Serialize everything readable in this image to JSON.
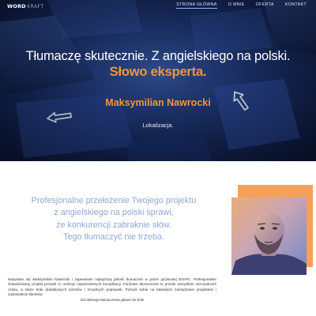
{
  "brand": {
    "word": "WORD",
    "kraft": "KRAFT"
  },
  "nav": {
    "items": [
      {
        "label": "STRONA GŁÓWNA"
      },
      {
        "label": "O MNIE"
      },
      {
        "label": "OFERTA"
      },
      {
        "label": "KONTAKT"
      }
    ]
  },
  "hero": {
    "headline": "Tłumaczę skutecznie. Z angielskiego na polski.",
    "tagline": "Słowo eksperta.",
    "name": "Maksymilian Nawrocki",
    "subtitle": "Lokalizacja."
  },
  "intro": {
    "lines": [
      "Profesjonalne przełożenie Twojego projektu",
      "z angielskiego na polski sprawi,",
      "że konkurencji zabraknie słów.",
      "Tego tłumaczyć nie trzeba."
    ]
  },
  "about": {
    "paragraph": "Nazywam się Maksymilian Nawrocki i zapewniam najwyższą jakość tłumaczeń w parze językowej EN>PL. Profesjonalnie zlokalizowany projekt pozwoli Ci uniknąć niepotrzebnych komplikacji. Fachowe tłumaczenie to przede wszystkim oszczędność czasu, a także brak dodatkowych kosztów i żmudnych poprawek. Pozwól sobie na łatwiejsze zarządzanie projektami i zadowolenie klientów.",
    "closing": "Od dobrego tłumaczenia głowa nie boli!"
  },
  "colors": {
    "accent": "#f39539",
    "hero_bg": "#1d3470",
    "lead_text": "#8ea7d8"
  }
}
